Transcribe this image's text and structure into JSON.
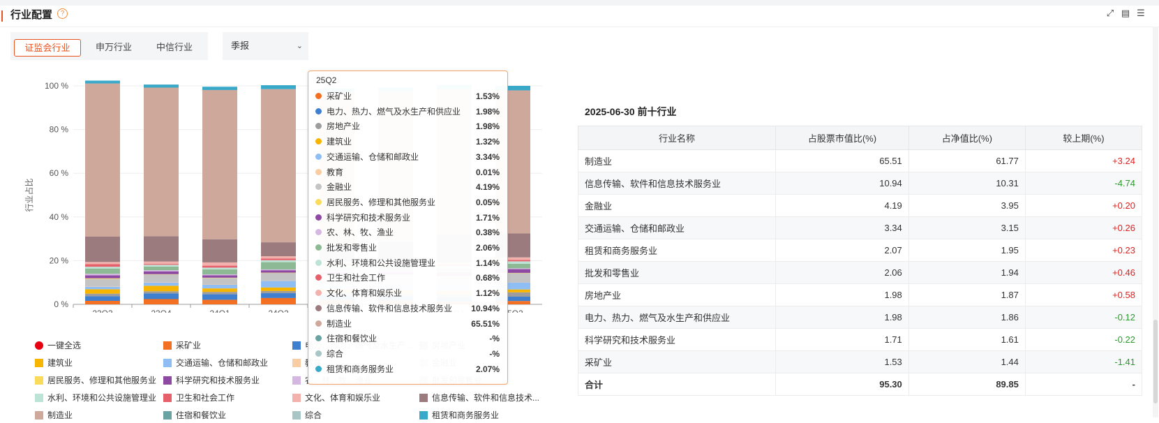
{
  "header": {
    "title": "行业配置",
    "help": "?"
  },
  "tools": [
    {
      "icon": "chart-export-icon",
      "glyph": "⤢"
    },
    {
      "icon": "excel-export-icon",
      "glyph": "▤"
    },
    {
      "icon": "list-icon",
      "glyph": "☰"
    }
  ],
  "tabs": [
    {
      "label": "证监会行业",
      "active": true
    },
    {
      "label": "申万行业",
      "active": false
    },
    {
      "label": "中信行业",
      "active": false
    }
  ],
  "period_select": {
    "value": "季报",
    "caret": "⌄"
  },
  "chart_data": {
    "type": "bar",
    "stacked": true,
    "ylabel": "行业占比",
    "ylim": [
      0,
      100
    ],
    "yticks": [
      "0 %",
      "20 %",
      "40 %",
      "60 %",
      "80 %",
      "100 %"
    ],
    "categories": [
      "23Q3",
      "23Q4",
      "24Q1",
      "24Q2",
      "24Q3",
      "24Q4",
      "25Q1",
      "25Q2"
    ],
    "colors": [
      "#f36f21",
      "#3f7fd0",
      "#9d9d9d",
      "#f7b500",
      "#8fbef5",
      "#f8cda3",
      "#c4c4c4",
      "#fadb5b",
      "#8e4aa3",
      "#d5b8e2",
      "#8dba94",
      "#bde3d6",
      "#e5606a",
      "#f2b1ac",
      "#9b7b7d",
      "#cfa89c",
      "#6ba3a3",
      "#a8c6c6",
      "#39a9c9"
    ],
    "series": [
      {
        "name": "采矿业",
        "values": [
          1.6,
          2.4,
          2.1,
          2.9,
          1.9,
          1.7,
          1.2,
          1.53
        ]
      },
      {
        "name": "电力、热力、燃气及水生产和供应业",
        "values": [
          2.1,
          2.6,
          2.5,
          2.2,
          2.1,
          2.0,
          2.1,
          1.98
        ]
      },
      {
        "name": "房地产业",
        "values": [
          1.2,
          1.0,
          1.1,
          1.0,
          1.4,
          1.3,
          1.4,
          1.98
        ]
      },
      {
        "name": "建筑业",
        "values": [
          2.0,
          2.5,
          1.6,
          1.6,
          1.5,
          1.4,
          1.5,
          1.32
        ]
      },
      {
        "name": "交通运输、仓储和邮政业",
        "values": [
          1.2,
          1.5,
          1.7,
          3.1,
          2.6,
          2.7,
          3.0,
          3.34
        ]
      },
      {
        "name": "教育",
        "values": [
          0.1,
          0.1,
          0.1,
          0.1,
          0.1,
          0.1,
          0.1,
          0.01
        ]
      },
      {
        "name": "金融业",
        "values": [
          3.4,
          3.6,
          3.0,
          3.5,
          3.8,
          4.2,
          3.6,
          4.19
        ]
      },
      {
        "name": "居民服务、修理和其他服务业",
        "values": [
          0.3,
          0.1,
          0.1,
          0.1,
          0.1,
          0.1,
          0.1,
          0.05
        ]
      },
      {
        "name": "科学研究和技术服务业",
        "values": [
          1.4,
          1.3,
          1.1,
          1.1,
          1.2,
          1.4,
          1.6,
          1.71
        ]
      },
      {
        "name": "农、林、牧、渔业",
        "values": [
          0.7,
          0.5,
          0.4,
          0.4,
          0.3,
          0.3,
          0.3,
          0.38
        ]
      },
      {
        "name": "批发和零售业",
        "values": [
          2.4,
          1.7,
          2.3,
          3.3,
          2.0,
          1.7,
          1.6,
          2.06
        ]
      },
      {
        "name": "水利、环境和公共设施管理业",
        "values": [
          0.8,
          0.8,
          0.8,
          0.9,
          0.9,
          0.9,
          1.0,
          1.14
        ]
      },
      {
        "name": "卫生和社会工作",
        "values": [
          1.2,
          0.4,
          0.9,
          0.8,
          0.7,
          0.6,
          0.6,
          0.68
        ]
      },
      {
        "name": "文化、体育和娱乐业",
        "values": [
          1.0,
          1.1,
          1.5,
          1.0,
          1.1,
          1.1,
          1.1,
          1.12
        ]
      },
      {
        "name": "信息传输、软件和信息技术服务业",
        "values": [
          11.6,
          11.6,
          10.6,
          6.4,
          6.8,
          9.0,
          12.8,
          10.94
        ]
      },
      {
        "name": "制造业",
        "values": [
          70.1,
          68.0,
          68.3,
          70.1,
          70.3,
          68.7,
          66.4,
          65.51
        ]
      },
      {
        "name": "住宿和餐饮业",
        "values": [
          0,
          0,
          0,
          0,
          0,
          0,
          0,
          0
        ]
      },
      {
        "name": "综合",
        "values": [
          0,
          0,
          0,
          0,
          0,
          0,
          0,
          0
        ]
      },
      {
        "name": "租赁和商务服务业",
        "values": [
          1.3,
          1.4,
          1.5,
          1.8,
          2.0,
          2.0,
          2.0,
          2.07
        ]
      }
    ]
  },
  "legend": {
    "select_all": "一键全选",
    "items": [
      "采矿业",
      "电力、热力、燃气及水生产...",
      "房地产业",
      "建筑业",
      "交通运输、仓储和邮政业",
      "教育",
      "金融业",
      "居民服务、修理和其他服务业",
      "科学研究和技术服务业",
      "农、林、牧、渔业",
      "批发和零售业",
      "水利、环境和公共设施管理业",
      "卫生和社会工作",
      "文化、体育和娱乐业",
      "信息传输、软件和信息技术...",
      "制造业",
      "住宿和餐饮业",
      "综合",
      "租赁和商务服务业"
    ]
  },
  "tooltip": {
    "period": "25Q2",
    "rows": [
      {
        "name": "采矿业",
        "value": "1.53%"
      },
      {
        "name": "电力、热力、燃气及水生产和供应业",
        "value": "1.98%"
      },
      {
        "name": "房地产业",
        "value": "1.98%"
      },
      {
        "name": "建筑业",
        "value": "1.32%"
      },
      {
        "name": "交通运输、仓储和邮政业",
        "value": "3.34%"
      },
      {
        "name": "教育",
        "value": "0.01%"
      },
      {
        "name": "金融业",
        "value": "4.19%"
      },
      {
        "name": "居民服务、修理和其他服务业",
        "value": "0.05%"
      },
      {
        "name": "科学研究和技术服务业",
        "value": "1.71%"
      },
      {
        "name": "农、林、牧、渔业",
        "value": "0.38%"
      },
      {
        "name": "批发和零售业",
        "value": "2.06%"
      },
      {
        "name": "水利、环境和公共设施管理业",
        "value": "1.14%"
      },
      {
        "name": "卫生和社会工作",
        "value": "0.68%"
      },
      {
        "name": "文化、体育和娱乐业",
        "value": "1.12%"
      },
      {
        "name": "信息传输、软件和信息技术服务业",
        "value": "10.94%"
      },
      {
        "name": "制造业",
        "value": "65.51%"
      },
      {
        "name": "住宿和餐饮业",
        "value": "-%"
      },
      {
        "name": "综合",
        "value": "-%"
      },
      {
        "name": "租赁和商务服务业",
        "value": "2.07%"
      }
    ]
  },
  "top10": {
    "title": "2025-06-30 前十行业",
    "columns": [
      "行业名称",
      "占股票市值比(%)",
      "占净值比(%)",
      "较上期(%)"
    ],
    "rows": [
      [
        "制造业",
        "65.51",
        "61.77",
        "+3.24"
      ],
      [
        "信息传输、软件和信息技术服务业",
        "10.94",
        "10.31",
        "-4.74"
      ],
      [
        "金融业",
        "4.19",
        "3.95",
        "+0.20"
      ],
      [
        "交通运输、仓储和邮政业",
        "3.34",
        "3.15",
        "+0.26"
      ],
      [
        "租赁和商务服务业",
        "2.07",
        "1.95",
        "+0.23"
      ],
      [
        "批发和零售业",
        "2.06",
        "1.94",
        "+0.46"
      ],
      [
        "房地产业",
        "1.98",
        "1.87",
        "+0.58"
      ],
      [
        "电力、热力、燃气及水生产和供应业",
        "1.98",
        "1.86",
        "-0.12"
      ],
      [
        "科学研究和技术服务业",
        "1.71",
        "1.61",
        "-0.22"
      ],
      [
        "采矿业",
        "1.53",
        "1.44",
        "-1.41"
      ]
    ],
    "total": [
      "合计",
      "95.30",
      "89.85",
      "-"
    ]
  }
}
